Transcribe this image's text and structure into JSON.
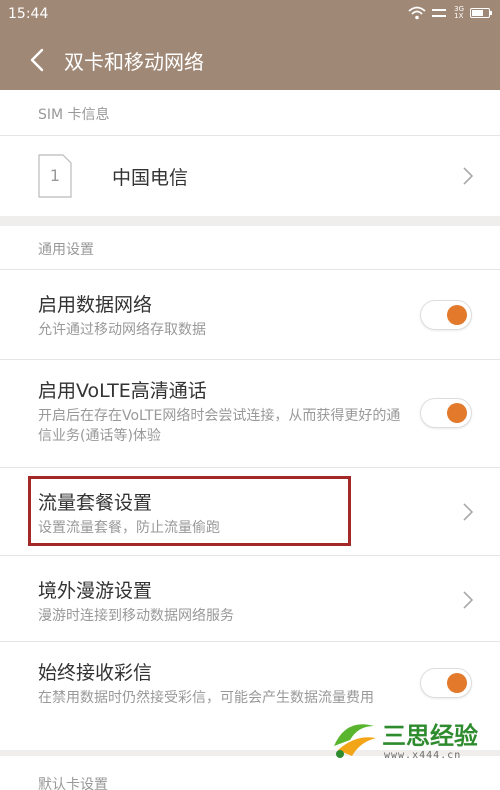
{
  "status_bar": {
    "time": "15:44",
    "network_labels": [
      "3G",
      "1X"
    ]
  },
  "header": {
    "title": "双卡和移动网络",
    "background": "#a08877"
  },
  "sim_section": {
    "header": "SIM 卡信息",
    "sim": {
      "slot": "1",
      "carrier": "中国电信"
    }
  },
  "general_section": {
    "header": "通用设置",
    "items": [
      {
        "title": "启用数据网络",
        "desc": "允许通过移动网络存取数据",
        "control": "toggle",
        "on": true
      },
      {
        "title": "启用VoLTE高清通话",
        "desc": "开启后在存在VoLTE网络时会尝试连接，从而获得更好的通信业务(通话等)体验",
        "control": "toggle",
        "on": true
      },
      {
        "title": "流量套餐设置",
        "desc": "设置流量套餐，防止流量偷跑",
        "control": "chevron"
      },
      {
        "title": "境外漫游设置",
        "desc": "漫游时连接到移动数据网络服务",
        "control": "chevron"
      },
      {
        "title": "始终接收彩信",
        "desc": "在禁用数据时仍然接受彩信，可能会产生数据流量费用",
        "control": "toggle",
        "on": true
      }
    ]
  },
  "default_section": {
    "header": "默认卡设置"
  },
  "watermark": {
    "title": "三思经验",
    "url": "www.x444.cn"
  },
  "colors": {
    "accent": "#e2792b",
    "highlight": "#a52828"
  }
}
